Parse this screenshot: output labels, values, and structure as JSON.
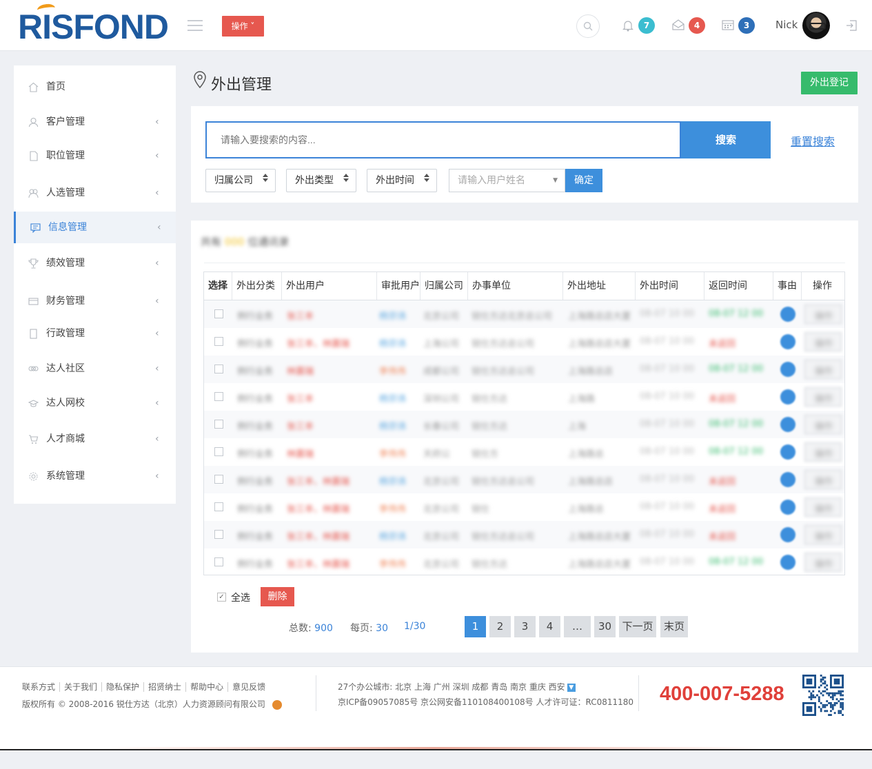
{
  "header": {
    "logo": "RISFOND",
    "op_label": "操作",
    "badges": [
      {
        "icon": "bell-icon",
        "count": "7",
        "color": "#3bbdd0"
      },
      {
        "icon": "mail-icon",
        "count": "4",
        "color": "#e6584f"
      },
      {
        "icon": "calendar-icon",
        "count": "3",
        "color": "#2e6fb8"
      }
    ],
    "user": "Nick"
  },
  "sidebar": {
    "items": [
      {
        "label": "首页",
        "icon": "home-icon",
        "arrow": ""
      },
      {
        "label": "客户管理",
        "icon": "user-icon",
        "arrow": "‹"
      },
      {
        "label": "职位管理",
        "icon": "document-icon",
        "arrow": "‹"
      },
      {
        "label": "人选管理",
        "icon": "users-icon",
        "arrow": "‹"
      },
      {
        "label": "信息管理",
        "icon": "message-icon",
        "arrow": "‹"
      },
      {
        "label": "绩效管理",
        "icon": "trophy-icon",
        "arrow": "‹"
      },
      {
        "label": "财务管理",
        "icon": "card-icon",
        "arrow": "‹"
      },
      {
        "label": "行政管理",
        "icon": "tablet-icon",
        "arrow": "‹"
      },
      {
        "label": "达人社区",
        "icon": "community-icon",
        "arrow": "‹"
      },
      {
        "label": "达人网校",
        "icon": "graduation-icon",
        "arrow": "‹"
      },
      {
        "label": "人才商城",
        "icon": "cart-icon",
        "arrow": "‹"
      },
      {
        "label": "系统管理",
        "icon": "settings-icon",
        "arrow": "‹"
      }
    ],
    "active_index": 4
  },
  "page": {
    "title": "外出管理",
    "register_label": "外出登记"
  },
  "filter": {
    "search_placeholder": "请输入要搜索的内容...",
    "search_label": "搜索",
    "reset_label": "重置搜索",
    "selects": [
      "归属公司",
      "外出类型",
      "外出时间"
    ],
    "name_placeholder": "请输入用户姓名",
    "confirm_label": "确定"
  },
  "table": {
    "summary_prefix": "共有",
    "summary_count": "000",
    "summary_suffix": "位通讯录",
    "headers": [
      "选择",
      "外出分类",
      "外出用户",
      "审批用户",
      "归属公司",
      "办事单位",
      "外出地址",
      "外出时间",
      "返回时间",
      "事由",
      "操作"
    ],
    "rows": [
      {
        "type": "例行业务",
        "user": "张三丰",
        "approver": "杨宗讳",
        "approver_color": "#5aa7e0",
        "company": "北京公司",
        "unit": "锐仕方达北京总公司",
        "addr": "上海路总店大厦",
        "out": "08-07 10 00",
        "ret": "08-07 12 00",
        "ret_color": "#36bb6c",
        "op": "操作"
      },
      {
        "type": "例行业务",
        "user": "张三丰、林震瑞",
        "approver": "杨宗讳",
        "approver_color": "#5aa7e0",
        "company": "上海公司",
        "unit": "锐仕方达总公司",
        "addr": "上海路总店大厦",
        "out": "08-07 10 00",
        "ret": "未返回",
        "ret_color": "#e6584f",
        "op": "操作"
      },
      {
        "type": "例行业务",
        "user": "林震瑞",
        "approver": "李伟伟",
        "approver_color": "#f0865a",
        "company": "成都公司",
        "unit": "锐仕方达总公司",
        "addr": "上海路总店",
        "out": "08-07 10 00",
        "ret": "08-07 12 00",
        "ret_color": "#36bb6c",
        "op": "操作"
      },
      {
        "type": "例行业务",
        "user": "张三丰",
        "approver": "杨宗讳",
        "approver_color": "#5aa7e0",
        "company": "深圳公司",
        "unit": "锐仕方达",
        "addr": "上海路",
        "out": "08-07 10 00",
        "ret": "未返回",
        "ret_color": "#e6584f",
        "op": "操作"
      },
      {
        "type": "例行业务",
        "user": "张三丰",
        "approver": "杨宗讳",
        "approver_color": "#5aa7e0",
        "company": "长春公司",
        "unit": "锐仕方达",
        "addr": "上海",
        "out": "08-07 10 00",
        "ret": "08-07 12 00",
        "ret_color": "#36bb6c",
        "op": "操作"
      },
      {
        "type": "例行业务",
        "user": "林震瑞",
        "approver": "李伟伟",
        "approver_color": "#f0865a",
        "company": "天府公",
        "unit": "锐仕方",
        "addr": "上海路总",
        "out": "08-07 10 00",
        "ret": "08-07 12 00",
        "ret_color": "#36bb6c",
        "op": "操作"
      },
      {
        "type": "例行业务",
        "user": "张三丰、林震瑞",
        "approver": "杨宗讳",
        "approver_color": "#5aa7e0",
        "company": "北京公司",
        "unit": "锐仕方达总公司",
        "addr": "上海路总店",
        "out": "08-07 10 00",
        "ret": "未返回",
        "ret_color": "#e6584f",
        "op": "操作"
      },
      {
        "type": "例行业务",
        "user": "张三丰、林震瑞",
        "approver": "李伟伟",
        "approver_color": "#f0865a",
        "company": "北京公司",
        "unit": "锐仕",
        "addr": "上海路总",
        "out": "08-07 10 00",
        "ret": "未返回",
        "ret_color": "#e6584f",
        "op": "操作"
      },
      {
        "type": "例行业务",
        "user": "张三丰、林震瑞",
        "approver": "杨宗讳",
        "approver_color": "#5aa7e0",
        "company": "北京公司",
        "unit": "锐仕方达总公司",
        "addr": "上海路总店大厦",
        "out": "08-07 10 00",
        "ret": "未返回",
        "ret_color": "#e6584f",
        "op": "操作"
      },
      {
        "type": "例行业务",
        "user": "张三丰、林震瑞",
        "approver": "李伟伟",
        "approver_color": "#f0865a",
        "company": "北京公司",
        "unit": "锐仕方达",
        "addr": "上海路总店大厦",
        "out": "08-07 10 00",
        "ret": "08-07 12 00",
        "ret_color": "#36bb6c",
        "op": "操作"
      }
    ]
  },
  "bulk": {
    "select_all": "全选",
    "delete": "删除"
  },
  "pagination": {
    "total_label": "总数:",
    "total": "900",
    "per_label": "每页:",
    "per": "30",
    "page_info": "1/30",
    "pages": [
      "1",
      "2",
      "3",
      "4",
      "…",
      "30",
      "下一页",
      "末页"
    ],
    "current": "1"
  },
  "footer": {
    "links": [
      "联系方式",
      "关于我们",
      "隐私保护",
      "招贤纳士",
      "帮助中心",
      "意见反馈"
    ],
    "copyright": "版权所有 © 2008-2016  锐仕方达（北京）人力资源顾问有限公司",
    "cities": "27个办公城市: 北京  上海  广州  深圳  成都  青岛  南京  重庆  西安",
    "icp": "京ICP备09057085号  京公网安备110108400108号  人才许可证：RC0811180",
    "phone": "400-007-5288"
  }
}
